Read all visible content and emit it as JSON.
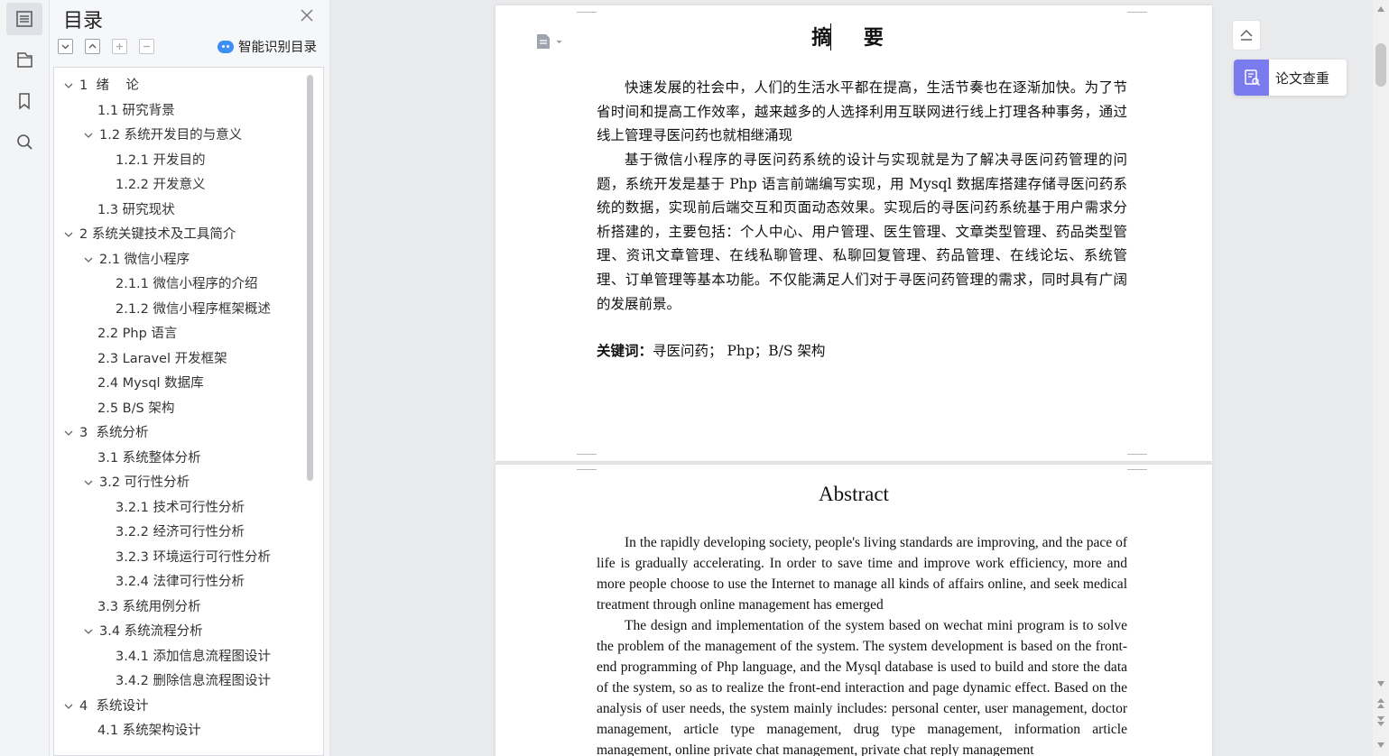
{
  "rail": {
    "items": [
      {
        "name": "toc-rail-icon",
        "active": true
      },
      {
        "name": "hierarchy-icon"
      },
      {
        "name": "bookmark-icon"
      },
      {
        "name": "search-icon"
      }
    ]
  },
  "toc": {
    "title": "目录",
    "smart_label": "智能识别目录",
    "items": [
      {
        "label": "1  绪    论",
        "level": 1,
        "expanded": true
      },
      {
        "label": "1.1 研究背景",
        "level": 2
      },
      {
        "label": "1.2 系统开发目的与意义",
        "level": 2,
        "expanded": true
      },
      {
        "label": "1.2.1 开发目的",
        "level": 3
      },
      {
        "label": "1.2.2 开发意义",
        "level": 3
      },
      {
        "label": "1.3 研究现状",
        "level": 2
      },
      {
        "label": "2 系统关键技术及工具简介",
        "level": 1,
        "expanded": true
      },
      {
        "label": "2.1 微信小程序",
        "level": 2,
        "expanded": true
      },
      {
        "label": "2.1.1 微信小程序的介绍",
        "level": 3
      },
      {
        "label": "2.1.2 微信小程序框架概述",
        "level": 3
      },
      {
        "label": "2.2 Php 语言",
        "level": 2
      },
      {
        "label": "2.3 Laravel 开发框架",
        "level": 2
      },
      {
        "label": "2.4 Mysql 数据库",
        "level": 2
      },
      {
        "label": "2.5 B/S 架构",
        "level": 2
      },
      {
        "label": "3  系统分析",
        "level": 1,
        "expanded": true
      },
      {
        "label": "3.1 系统整体分析",
        "level": 2
      },
      {
        "label": "3.2 可行性分析",
        "level": 2,
        "expanded": true
      },
      {
        "label": "3.2.1 技术可行性分析",
        "level": 3
      },
      {
        "label": "3.2.2 经济可行性分析",
        "level": 3
      },
      {
        "label": "3.2.3 环境运行可行性分析",
        "level": 3
      },
      {
        "label": "3.2.4 法律可行性分析",
        "level": 3
      },
      {
        "label": "3.3 系统用例分析",
        "level": 2
      },
      {
        "label": "3.4 系统流程分析",
        "level": 2,
        "expanded": true
      },
      {
        "label": "3.4.1 添加信息流程图设计",
        "level": 3
      },
      {
        "label": "3.4.2 删除信息流程图设计",
        "level": 3
      },
      {
        "label": "4  系统设计",
        "level": 1,
        "expanded": true
      },
      {
        "label": "4.1 系统架构设计",
        "level": 2
      }
    ]
  },
  "doc": {
    "cn_title": "摘 要",
    "cn_paragraphs": [
      "快速发展的社会中，人们的生活水平都在提高，生活节奏也在逐渐加快。为了节省时间和提高工作效率，越来越多的人选择利用互联网进行线上打理各种事务，通过线上管理寻医问药也就相继涌现",
      "基于微信小程序的寻医问药系统的设计与实现就是为了解决寻医问药管理的问题，系统开发是基于 Php 语言前端编写实现，用 Mysql 数据库搭建存储寻医问药系统的数据，实现前后端交互和页面动态效果。实现后的寻医问药系统基于用户需求分析搭建的，主要包括：个人中心、用户管理、医生管理、文章类型管理、药品类型管理、资讯文章管理、在线私聊管理、私聊回复管理、药品管理、在线论坛、系统管理、订单管理等基本功能。不仅能满足人们对于寻医问药管理的需求，同时具有广阔的发展前景。"
    ],
    "keywords_label": "关键词：",
    "keywords_value": "寻医问药；  Php；B/S 架构",
    "en_title": "Abstract",
    "en_paragraphs": [
      "In the rapidly developing society, people's living standards are improving, and the pace of life is gradually accelerating. In order to save time and improve work efficiency, more and more people choose to use the Internet to manage all kinds of affairs online, and seek medical treatment through online management has emerged",
      "The design and implementation of the system based on wechat mini program is to solve the problem of the management of the system. The system development is based on the front-end programming of Php language, and the Mysql database is used to build and store the data of the system, so as to realize the front-end interaction and page dynamic effect. Based on the analysis of user needs, the system mainly includes: personal center, user management, doctor management, article type management, drug type management, information article management, online private chat management, private chat reply management"
    ]
  },
  "right_tools": {
    "check_label": "论文查重"
  },
  "colors": {
    "accent": "#7b7bf0",
    "smart_icon": "#3d8ef5"
  }
}
